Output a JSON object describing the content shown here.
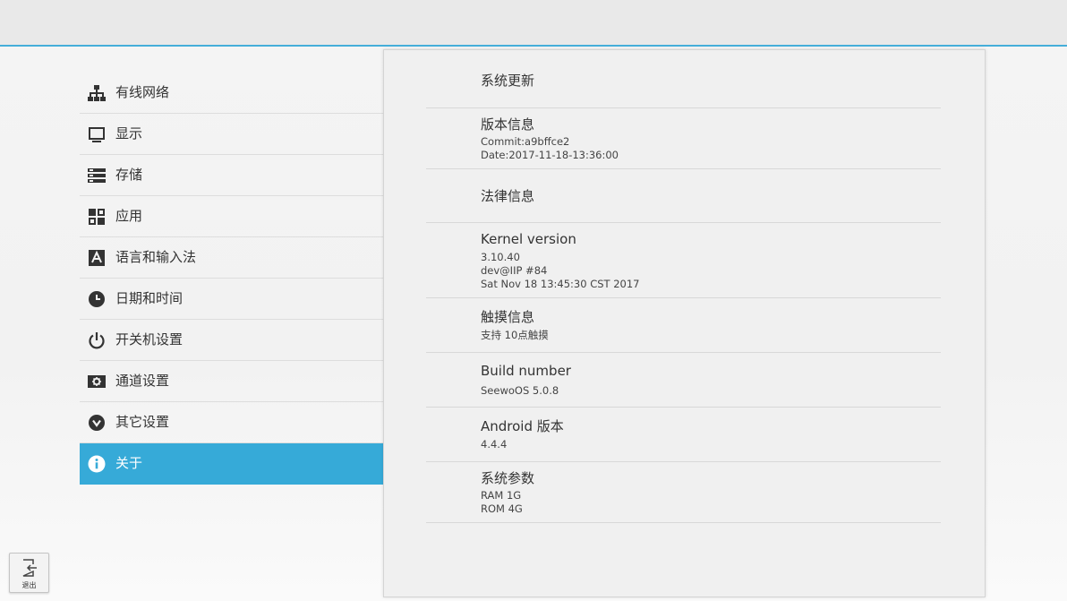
{
  "sidebar": {
    "items": [
      {
        "label": "有线网络",
        "icon": "network-icon"
      },
      {
        "label": "显示",
        "icon": "display-icon"
      },
      {
        "label": "存储",
        "icon": "storage-icon"
      },
      {
        "label": "应用",
        "icon": "apps-icon"
      },
      {
        "label": "语言和输入法",
        "icon": "language-icon"
      },
      {
        "label": "日期和时间",
        "icon": "clock-icon"
      },
      {
        "label": "开关机设置",
        "icon": "power-icon"
      },
      {
        "label": "通道设置",
        "icon": "channel-icon"
      },
      {
        "label": "其它设置",
        "icon": "chevron-down-icon"
      },
      {
        "label": "关于",
        "icon": "info-icon",
        "active": true
      }
    ]
  },
  "about": {
    "system_update": {
      "title": "系统更新"
    },
    "version_info": {
      "title": "版本信息",
      "commit": "Commit:a9bffce2",
      "date": "Date:2017-11-18-13:36:00"
    },
    "legal_info": {
      "title": "法律信息"
    },
    "kernel": {
      "title": "Kernel version",
      "line1": "3.10.40",
      "line2": "dev@IIP #84",
      "line3": "Sat Nov 18 13:45:30 CST 2017"
    },
    "touch": {
      "title": "触摸信息",
      "value": "支持 10点触摸"
    },
    "build": {
      "title": "Build number",
      "value": "SeewoOS 5.0.8"
    },
    "android": {
      "title": "Android 版本",
      "value": "4.4.4"
    },
    "params": {
      "title": "系统参数",
      "ram": "RAM  1G",
      "rom": "ROM  4G"
    }
  },
  "exit": {
    "label": "退出",
    "icon": "exit-icon"
  },
  "colors": {
    "accent": "#36aad8",
    "topbar_line": "#45aed9"
  }
}
